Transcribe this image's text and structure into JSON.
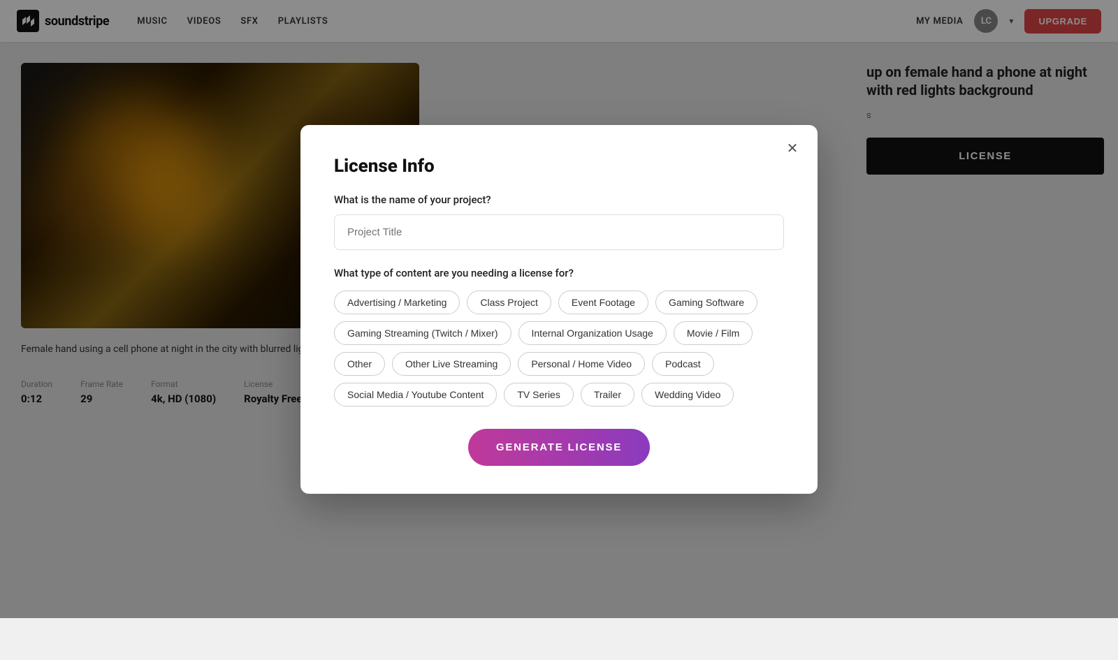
{
  "nav": {
    "logo_text": "soundstripe",
    "links": [
      "MUSIC",
      "VIDEOS",
      "SFX",
      "PLAYLISTS"
    ],
    "my_media": "MY MEDIA",
    "user_initials": "LC",
    "upgrade_label": "UPGRADE"
  },
  "video": {
    "description": "Female hand using a cell phone at night in the city with blurred lights in the background",
    "meta": {
      "duration_label": "Duration",
      "duration_value": "0:12",
      "frame_rate_label": "Frame Rate",
      "frame_rate_value": "29",
      "format_label": "Format",
      "format_value": "4k, HD (1080)",
      "license_label": "License",
      "license_value": "Royalty Free"
    }
  },
  "right_panel": {
    "title": "up on female hand\na phone at night with\nred lights background",
    "count": "s",
    "license_button": "LICENSE"
  },
  "modal": {
    "title": "License Info",
    "project_question": "What is the name of your project?",
    "project_placeholder": "Project Title",
    "content_question": "What type of content are you needing a license for?",
    "tags": [
      "Advertising / Marketing",
      "Class Project",
      "Event Footage",
      "Gaming Software",
      "Gaming Streaming (Twitch / Mixer)",
      "Internal Organization Usage",
      "Movie / Film",
      "Other",
      "Other Live Streaming",
      "Personal / Home Video",
      "Podcast",
      "Social Media / Youtube Content",
      "TV Series",
      "Trailer",
      "Wedding Video"
    ],
    "generate_label": "GENERATE LICENSE"
  }
}
